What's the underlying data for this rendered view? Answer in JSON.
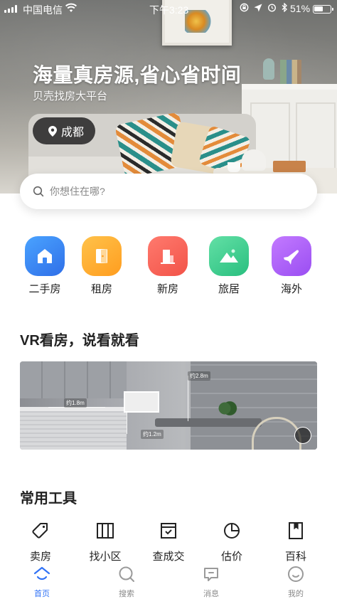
{
  "status_bar": {
    "carrier": "中国电信",
    "time": "下午3:23",
    "battery": "51%"
  },
  "hero": {
    "title": "海量真房源,省心省时间",
    "subtitle": "贝壳找房大平台",
    "city": "成都"
  },
  "search": {
    "placeholder": "你想住在哪?"
  },
  "quick_nav": [
    {
      "label": "二手房",
      "icon": "house-icon",
      "color": "#3a86f5"
    },
    {
      "label": "租房",
      "icon": "door-icon",
      "color": "#ffae2e"
    },
    {
      "label": "新房",
      "icon": "building-icon",
      "color": "#f76358"
    },
    {
      "label": "旅居",
      "icon": "mountain-icon",
      "color": "#3ecf8e"
    },
    {
      "label": "海外",
      "icon": "plane-icon",
      "color": "#b062fa"
    }
  ],
  "vr_section": {
    "title": "VR看房，说看就看",
    "tags": [
      "约2.8m",
      "约1.8m",
      "约1.2m"
    ]
  },
  "tools_section": {
    "title": "常用工具",
    "items": [
      {
        "label": "卖房",
        "icon": "price-tag-icon"
      },
      {
        "label": "找小区",
        "icon": "map-book-icon"
      },
      {
        "label": "查成交",
        "icon": "inbox-check-icon"
      },
      {
        "label": "估价",
        "icon": "pie-chart-icon"
      },
      {
        "label": "百科",
        "icon": "bookmark-book-icon"
      }
    ]
  },
  "tab_bar": {
    "accent": "#3072f6",
    "items": [
      {
        "label": "首页",
        "icon": "home-tab-icon",
        "active": true
      },
      {
        "label": "搜索",
        "icon": "search-tab-icon",
        "active": false
      },
      {
        "label": "消息",
        "icon": "message-tab-icon",
        "active": false
      },
      {
        "label": "我的",
        "icon": "profile-tab-icon",
        "active": false
      }
    ]
  }
}
